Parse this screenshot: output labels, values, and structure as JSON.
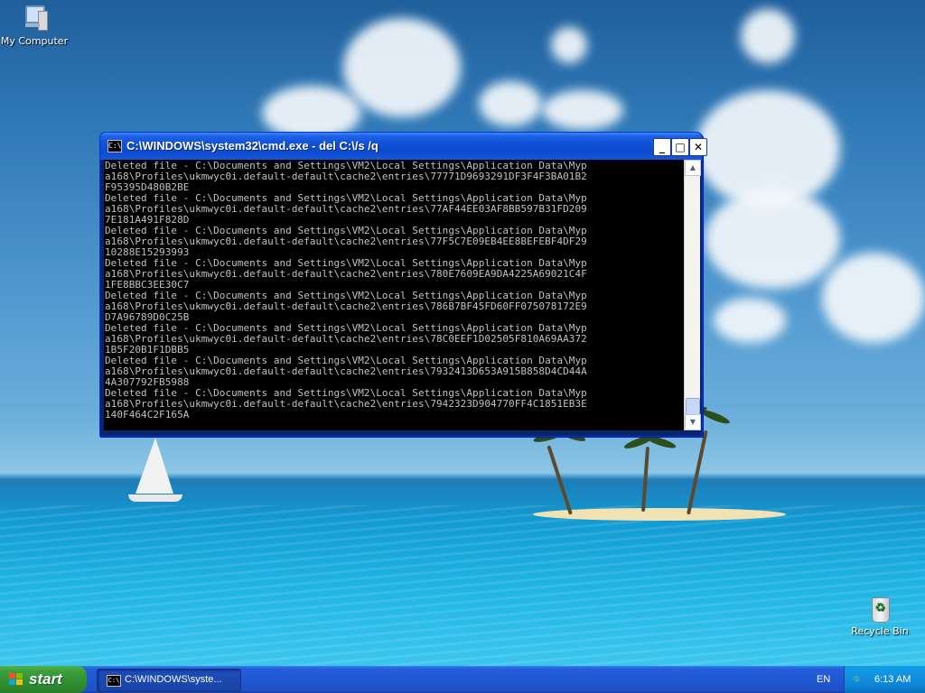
{
  "desktop": {
    "icons": [
      {
        "label": "My Computer",
        "icon": "my-computer-icon"
      },
      {
        "label": "Recycle Bin",
        "icon": "recycle-bin-icon"
      }
    ]
  },
  "window": {
    "title": "C:\\WINDOWS\\system32\\cmd.exe - del C:\\/s /q",
    "icon": "cmd-icon",
    "console_lines": [
      "Deleted file - C:\\Documents and Settings\\VM2\\Local Settings\\Application Data\\Myp",
      "a168\\Profiles\\ukmwyc0i.default-default\\cache2\\entries\\77771D9693291DF3F4F3BA01B2",
      "F95395D480B2BE",
      "Deleted file - C:\\Documents and Settings\\VM2\\Local Settings\\Application Data\\Myp",
      "a168\\Profiles\\ukmwyc0i.default-default\\cache2\\entries\\77AF44EE03AF8BB597B31FD209",
      "7E181A491F828D",
      "Deleted file - C:\\Documents and Settings\\VM2\\Local Settings\\Application Data\\Myp",
      "a168\\Profiles\\ukmwyc0i.default-default\\cache2\\entries\\77F5C7E09EB4EE8BEFEBF4DF29",
      "10288E15293993",
      "Deleted file - C:\\Documents and Settings\\VM2\\Local Settings\\Application Data\\Myp",
      "a168\\Profiles\\ukmwyc0i.default-default\\cache2\\entries\\780E7609EA9DA4225A69021C4F",
      "1FE8BBC3EE30C7",
      "Deleted file - C:\\Documents and Settings\\VM2\\Local Settings\\Application Data\\Myp",
      "a168\\Profiles\\ukmwyc0i.default-default\\cache2\\entries\\786B7BF45FD60FF075078172E9",
      "D7A96789D0C25B",
      "Deleted file - C:\\Documents and Settings\\VM2\\Local Settings\\Application Data\\Myp",
      "a168\\Profiles\\ukmwyc0i.default-default\\cache2\\entries\\78C0EEF1D02505F810A69AA372",
      "1B5F20B1F1DBB5",
      "Deleted file - C:\\Documents and Settings\\VM2\\Local Settings\\Application Data\\Myp",
      "a168\\Profiles\\ukmwyc0i.default-default\\cache2\\entries\\7932413D653A915B858D4CD44A",
      "4A307792FB5988",
      "Deleted file - C:\\Documents and Settings\\VM2\\Local Settings\\Application Data\\Myp",
      "a168\\Profiles\\ukmwyc0i.default-default\\cache2\\entries\\7942323D904770FF4C1851EB3E",
      "140F464C2F165A"
    ],
    "buttons": {
      "minimize": "_",
      "maximize": "□",
      "close": "✕"
    }
  },
  "taskbar": {
    "start_label": "start",
    "start_colors": [
      "#f35325",
      "#81bc06",
      "#05a6f0",
      "#ffba08"
    ],
    "task_label": "C:\\WINDOWS\\syste...",
    "language": "EN",
    "clock": "6:13 AM"
  }
}
